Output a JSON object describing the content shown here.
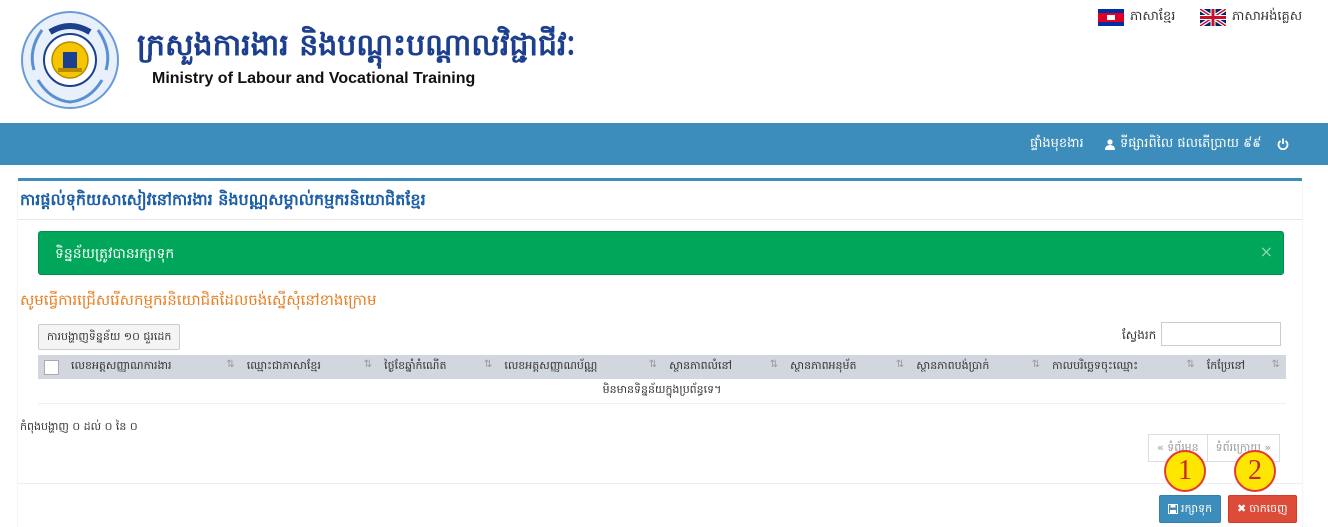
{
  "header": {
    "title_kh": "ក្រសួងការងារ និងបណ្តុះបណ្តាលវិជ្ជាជីវៈ",
    "title_en": "Ministry of Labour and Vocational Training",
    "lang_kh": "ភាសាខ្មែរ",
    "lang_en": "ភាសាអង់គ្លេស"
  },
  "navbar": {
    "dashboard": "ផ្ទាំងមុខងារ",
    "user": "ទីផ្សារពិលៃ ផលតើប្រាយ ៩៩",
    "user_icon": "user-icon",
    "power_icon": "power-icon",
    "accent": "#3c8dbc"
  },
  "panel": {
    "title": "ការផ្តល់ទុកិយសាសៀវនៅការងារ និងបណ្ណសម្គាល់កម្មករនិយោជិតខ្មែរ",
    "alert_text": "ទិន្នន័យត្រូវបានរក្សាទុក",
    "alert_close": "×",
    "instruction": "សូមធ្វើការជ្រើសរើសកម្មករនិយោជិតដែលចង់ស្នើសុំនៅខាងក្រោម",
    "length_button": "ការបង្ហាញទិន្នន័យ ១០ ជួរដេក",
    "search_label": "ស្វែងរក",
    "search_value": "",
    "columns": [
      "លេខអត្តសញ្ញាណការងារ",
      "ឈ្មោះជាភាសាខ្មែរ",
      "ថ្ងៃខែឆ្នាំកំណើត",
      "លេខអត្តសញ្ញាណប័ណ្ណ",
      "ស្ថានភាពលំនៅ",
      "ស្ថានភាពអនុម័ត",
      "ស្ថានភាពបង់ប្រាក់",
      "កាលបរិច្ឆេទចុះឈ្មោះ",
      "កែប្រែនៅ"
    ],
    "empty_text": "មិនមានទិន្នន័យក្នុងប្រព័ន្ធទេ។",
    "info_text": "កំពុងបង្ហាញ ០ ដល់ ០ នៃ ០",
    "pager_prev": "« ទំព័រមុន",
    "pager_next": "ទំព័រក្រោយ »",
    "save_button": "រក្សាទុក",
    "exit_button": "ចាកចេញ",
    "save_color": "#3c8dbc",
    "exit_color": "#dd4b39",
    "alert_color": "#00a65a"
  },
  "markers": [
    "1",
    "2"
  ]
}
